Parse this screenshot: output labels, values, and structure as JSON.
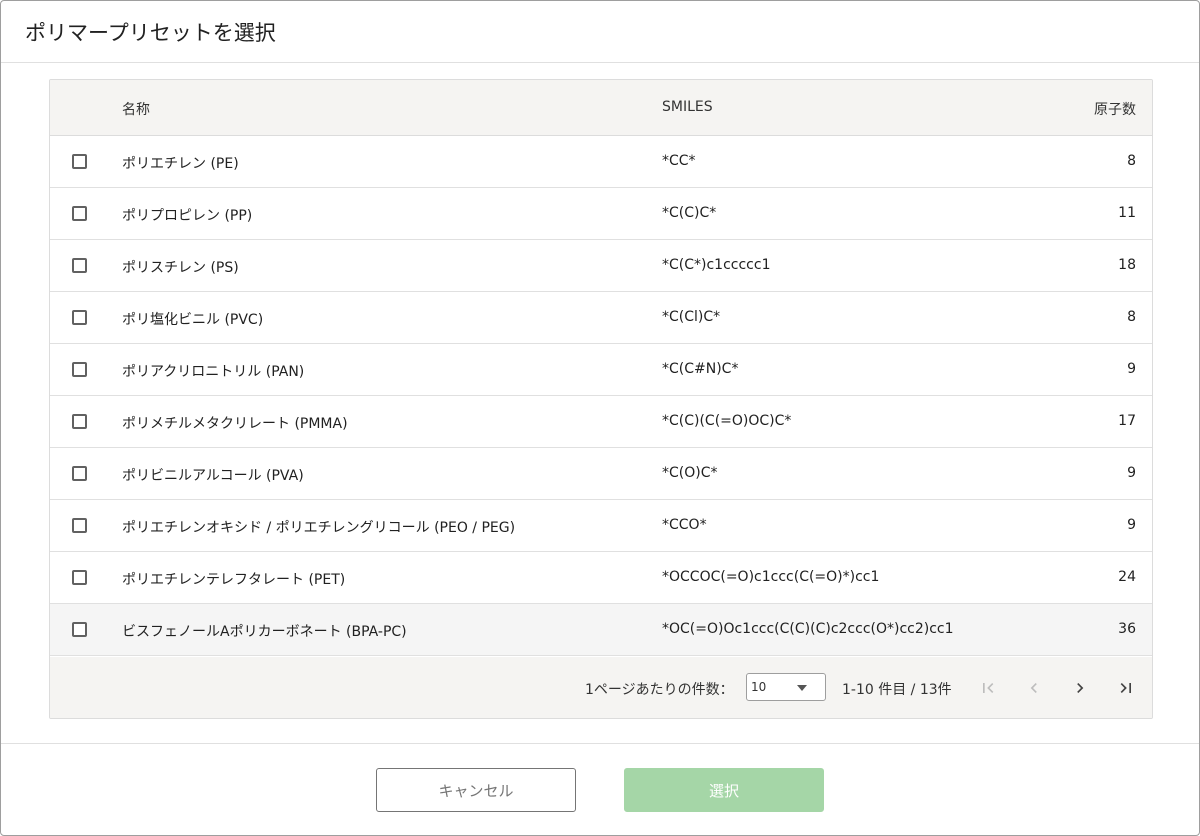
{
  "dialog": {
    "title": "ポリマープリセットを選択"
  },
  "table": {
    "headers": {
      "name": "名称",
      "smiles": "SMILES",
      "atoms": "原子数"
    },
    "rows": [
      {
        "name": "ポリエチレン (PE)",
        "smiles": "*CC*",
        "atoms": "8",
        "checked": false
      },
      {
        "name": "ポリプロピレン (PP)",
        "smiles": "*C(C)C*",
        "atoms": "11",
        "checked": false
      },
      {
        "name": "ポリスチレン (PS)",
        "smiles": "*C(C*)c1ccccc1",
        "atoms": "18",
        "checked": false
      },
      {
        "name": "ポリ塩化ビニル (PVC)",
        "smiles": "*C(Cl)C*",
        "atoms": "8",
        "checked": false
      },
      {
        "name": "ポリアクリロニトリル (PAN)",
        "smiles": "*C(C#N)C*",
        "atoms": "9",
        "checked": false
      },
      {
        "name": "ポリメチルメタクリレート (PMMA)",
        "smiles": "*C(C)(C(=O)OC)C*",
        "atoms": "17",
        "checked": false
      },
      {
        "name": "ポリビニルアルコール (PVA)",
        "smiles": "*C(O)C*",
        "atoms": "9",
        "checked": false
      },
      {
        "name": "ポリエチレンオキシド / ポリエチレングリコール (PEO / PEG)",
        "smiles": "*CCO*",
        "atoms": "9",
        "checked": false
      },
      {
        "name": "ポリエチレンテレフタレート (PET)",
        "smiles": "*OCCOC(=O)c1ccc(C(=O)*)cc1",
        "atoms": "24",
        "checked": false
      },
      {
        "name": "ビスフェノールAポリカーボネート (BPA-PC)",
        "smiles": "*OC(=O)Oc1ccc(C(C)(C)c2ccc(O*)cc2)cc1",
        "atoms": "36",
        "checked": false
      }
    ]
  },
  "pagination": {
    "per_page_label": "1ページあたりの件数：",
    "per_page_value": "10",
    "range_text": "1-10 件目 / 13件",
    "icons": [
      "first-page-icon",
      "prev-page-icon",
      "next-page-icon",
      "last-page-icon"
    ]
  },
  "actions": {
    "cancel_label": "キャンセル",
    "select_label": "選択"
  },
  "colors": {
    "select_button_disabled": "#a5d6a7",
    "header_bg": "#f5f4f2"
  }
}
